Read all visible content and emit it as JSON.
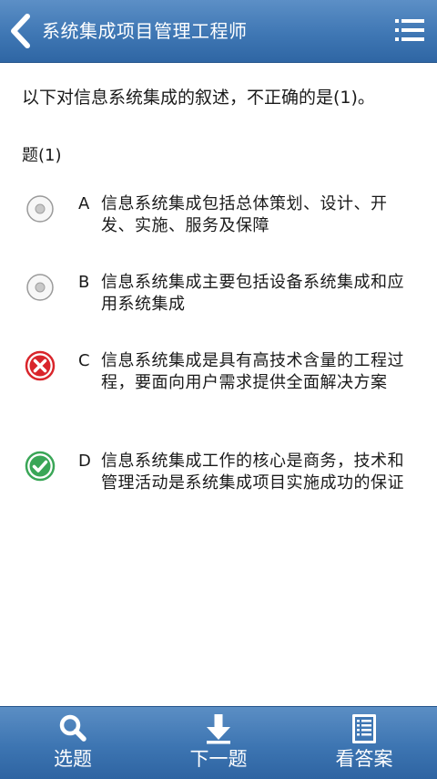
{
  "header": {
    "title": "系统集成项目管理工程师"
  },
  "question": {
    "text": "以下对信息系统集成的叙述，不正确的是(1)。",
    "sub_label": "题(1)"
  },
  "options": [
    {
      "letter": "A",
      "text": "信息系统集成包括总体策划、设计、开发、实施、服务及保障",
      "state": "unselected"
    },
    {
      "letter": "B",
      "text": "信息系统集成主要包括设备系统集成和应用系统集成",
      "state": "unselected"
    },
    {
      "letter": "C",
      "text": "信息系统集成是具有高技术含量的工程过程，要面向用户需求提供全面解决方案",
      "state": "wrong"
    },
    {
      "letter": "D",
      "text": "信息系统集成工作的核心是商务，技术和管理活动是系统集成项目实施成功的保证",
      "state": "correct"
    }
  ],
  "toolbar": {
    "select_label": "选题",
    "next_label": "下一题",
    "answer_label": "看答案"
  },
  "colors": {
    "bar_blue": "#3f77b4",
    "wrong_red": "#d9252b",
    "correct_green": "#3aa657"
  }
}
